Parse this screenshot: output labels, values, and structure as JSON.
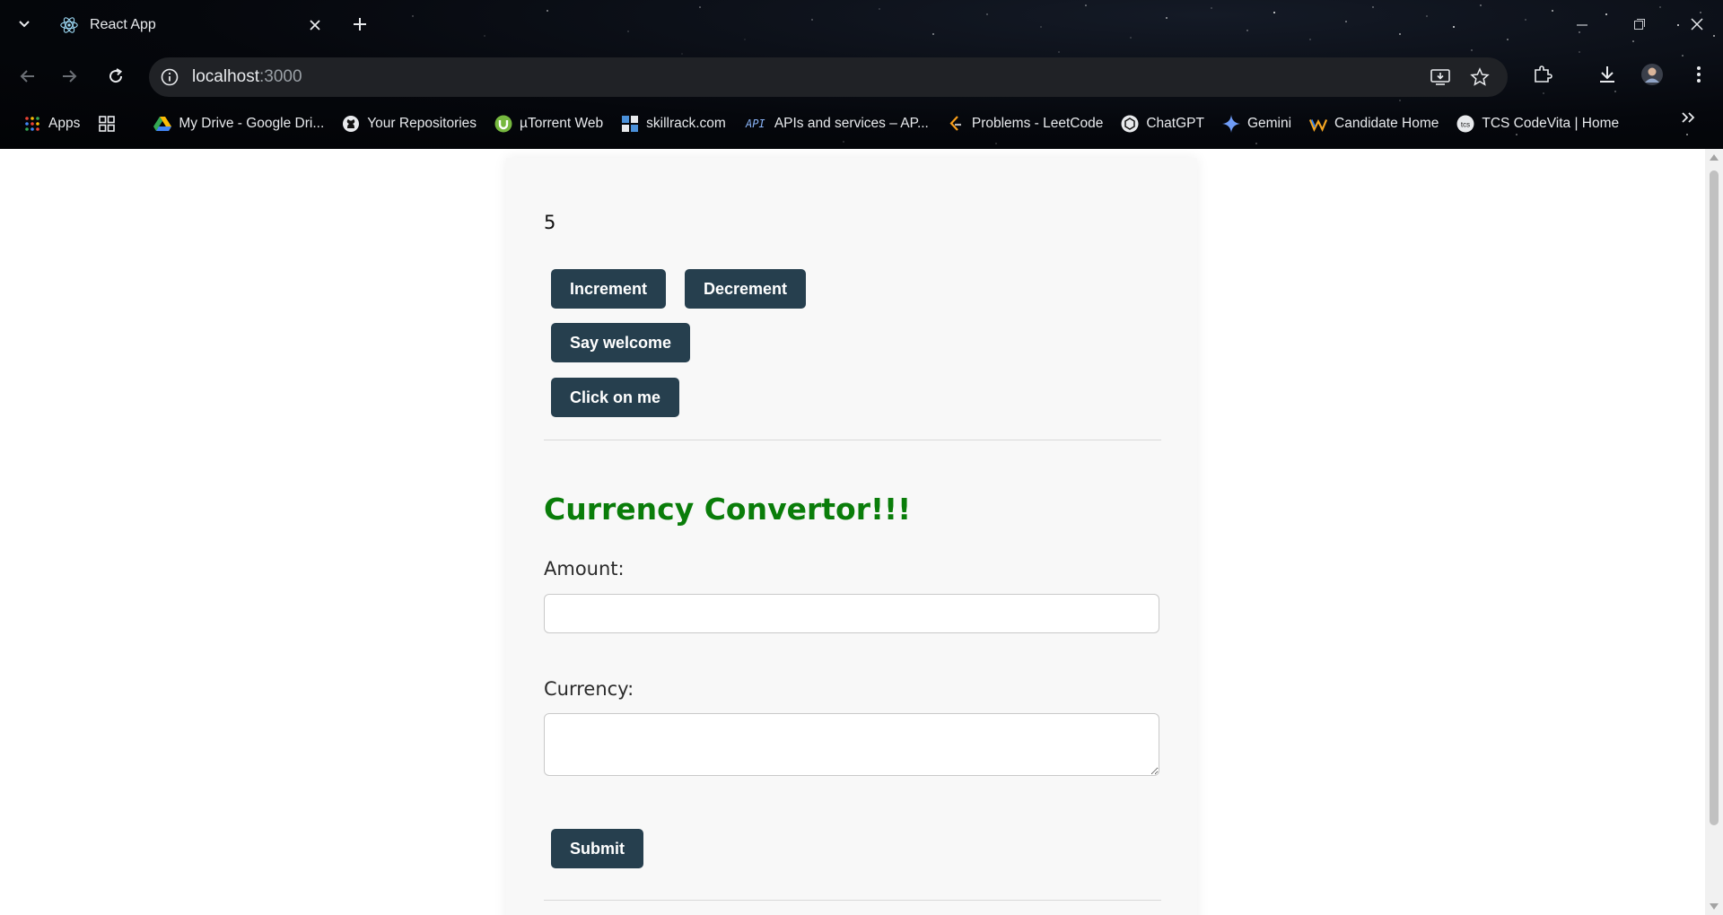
{
  "browser": {
    "tab_title": "React App",
    "url_host": "localhost",
    "url_port": ":3000",
    "bookmarks": [
      {
        "label": "Apps",
        "icon": "apps-grid-icon"
      },
      {
        "label": "",
        "icon": "tab-groups-icon"
      },
      {
        "label": "My Drive - Google Dri...",
        "icon": "google-drive-icon"
      },
      {
        "label": "Your Repositories",
        "icon": "github-icon"
      },
      {
        "label": "µTorrent Web",
        "icon": "utorrent-icon"
      },
      {
        "label": "skillrack.com",
        "icon": "skillrack-icon"
      },
      {
        "label": "APIs and services – AP...",
        "icon": "api-icon"
      },
      {
        "label": "Problems - LeetCode",
        "icon": "leetcode-icon"
      },
      {
        "label": "ChatGPT",
        "icon": "chatgpt-icon"
      },
      {
        "label": "Gemini",
        "icon": "gemini-icon"
      },
      {
        "label": "Candidate Home",
        "icon": "candidate-home-icon"
      },
      {
        "label": "TCS CodeVita | Home",
        "icon": "tcs-icon"
      }
    ]
  },
  "counter": {
    "value": "5",
    "increment_label": "Increment",
    "decrement_label": "Decrement",
    "say_welcome_label": "Say welcome",
    "click_on_me_label": "Click on me"
  },
  "converter": {
    "title": "Currency Convertor!!!",
    "title_color": "#0a7d0a",
    "amount_label": "Amount:",
    "amount_value": "",
    "currency_label": "Currency:",
    "currency_value": "",
    "submit_label": "Submit"
  },
  "colors": {
    "button_bg": "#263f4e",
    "card_bg": "#f8f8f8"
  }
}
